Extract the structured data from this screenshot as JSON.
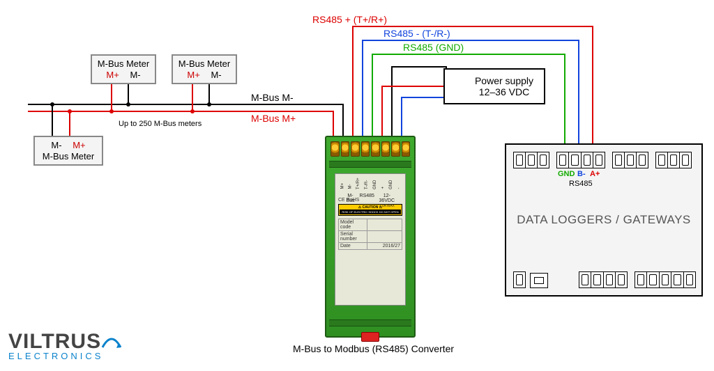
{
  "labels": {
    "rs485_plus": "RS485 + (T+/R+)",
    "rs485_minus": "RS485 - (T-/R-)",
    "rs485_gnd": "RS485 (GND)",
    "mbus_mminus": "M-Bus M-",
    "mbus_mplus": "M-Bus M+",
    "up_to": "Up to 250 M-Bus meters",
    "converter_caption": "M-Bus to Modbus (RS485) Converter",
    "logger_title": "DATA LOGGERS / GATEWAYS",
    "rs485_port": "RS485",
    "gnd": "GND",
    "bminus": "B-",
    "aplus": "A+"
  },
  "meter": {
    "title": "M-Bus Meter",
    "plus": "M+",
    "minus": "M-"
  },
  "psu": {
    "line1": "Power supply",
    "line2": "12–36 VDC"
  },
  "converter": {
    "pins": [
      "M+",
      "M-",
      "T+/R+",
      "T-/R-",
      "GND",
      "+",
      "GND",
      "-"
    ],
    "groups": [
      "M-Bus",
      "RS485",
      "12-36VDC"
    ],
    "sub": "2.0A MAX",
    "caution_title": "CAUTION",
    "caution_text": "RISK OF ELECTRIC SHOCK DO NOT OPEN",
    "model_label": "Model code",
    "serial_label": "Serial number",
    "date_label": "Date",
    "date_value": "2016/27",
    "marks": "CE  RoHS"
  },
  "logo": {
    "name": "VILTRUS",
    "sub": "ELECTRONICS"
  }
}
